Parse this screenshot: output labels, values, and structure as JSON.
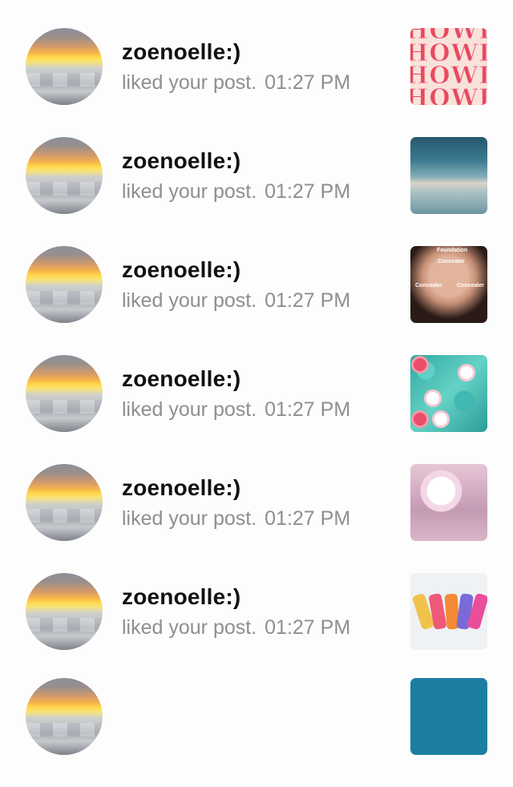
{
  "notifications": [
    {
      "username": "zoenoelle:)",
      "action": "liked your post.",
      "time": "01:27 PM",
      "thumb": "howdy-thumbnail"
    },
    {
      "username": "zoenoelle:)",
      "action": "liked your post.",
      "time": "01:27 PM",
      "thumb": "sea-thumbnail"
    },
    {
      "username": "zoenoelle:)",
      "action": "liked your post.",
      "time": "01:27 PM",
      "thumb": "makeup-thumbnail"
    },
    {
      "username": "zoenoelle:)",
      "action": "liked your post.",
      "time": "01:27 PM",
      "thumb": "pool-thumbnail"
    },
    {
      "username": "zoenoelle:)",
      "action": "liked your post.",
      "time": "01:27 PM",
      "thumb": "vanity-thumbnail"
    },
    {
      "username": "zoenoelle:)",
      "action": "liked your post.",
      "time": "01:27 PM",
      "thumb": "bottles-thumbnail"
    }
  ],
  "thumb_text": {
    "howdy": "HOWDY",
    "face_labels": [
      "Foundation",
      "Concealer",
      "Concealer",
      "Concealer"
    ]
  }
}
